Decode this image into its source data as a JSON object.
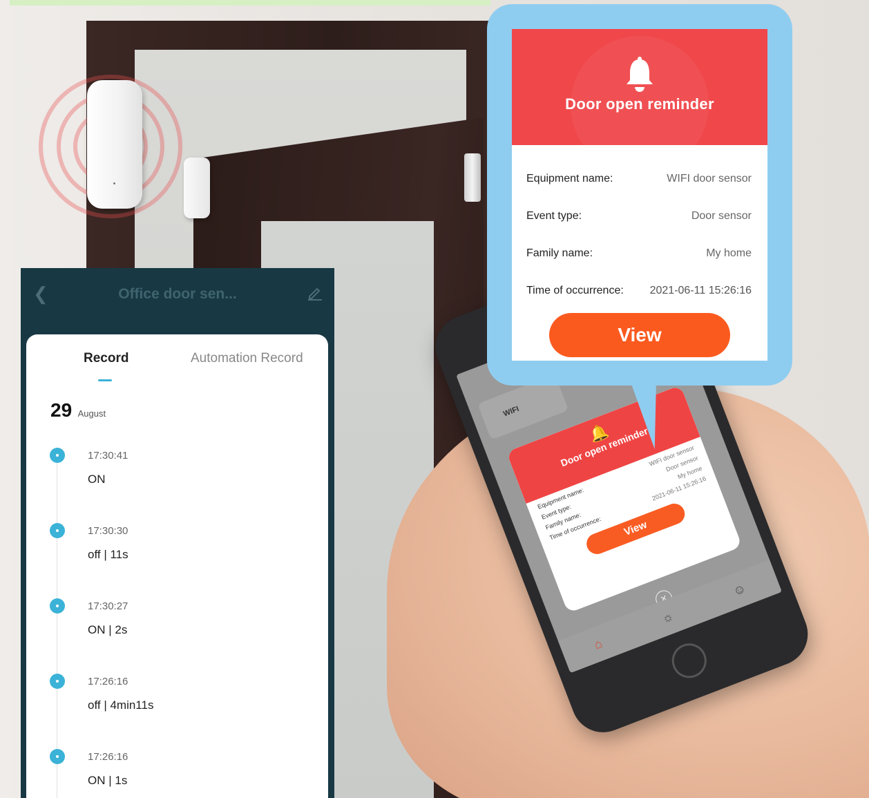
{
  "popup": {
    "title": "Door open reminder",
    "rows": [
      {
        "key": "Equipment name:",
        "value": "WIFI door sensor"
      },
      {
        "key": "Event type:",
        "value": "Door sensor"
      },
      {
        "key": "Family name:",
        "value": "My home"
      },
      {
        "key": "Time of occurrence:",
        "value": "2021-06-11 15:26:16"
      }
    ],
    "view_label": "View",
    "icon": "bell-icon",
    "header_color": "#f0474a",
    "button_color": "#fb5a1f",
    "bubble_color": "#8fcdf0"
  },
  "phone": {
    "popup_title": "Door open reminder",
    "rows": [
      {
        "key": "Equipment name:",
        "value": "WIFI door sensor"
      },
      {
        "key": "Event type:",
        "value": "Door sensor"
      },
      {
        "key": "Family name:",
        "value": "My home"
      },
      {
        "key": "Time of occurrence:",
        "value": "2021-06-11 15:26:16"
      }
    ],
    "view_label": "View",
    "device_card": "WIFI"
  },
  "app": {
    "title": "Office door sen...",
    "tabs": [
      "Record",
      "Automation Record"
    ],
    "active_tab": "Record",
    "date_day": "29",
    "date_month": "August",
    "accent_color": "#3bb2d7",
    "header_color": "#183944",
    "records": [
      {
        "time": "17:30:41",
        "state": "ON"
      },
      {
        "time": "17:30:30",
        "state": "off  | 11s"
      },
      {
        "time": "17:30:27",
        "state": "ON  | 2s"
      },
      {
        "time": "17:26:16",
        "state": "off  | 4min11s"
      },
      {
        "time": "17:26:16",
        "state": "ON  | 1s"
      }
    ]
  }
}
